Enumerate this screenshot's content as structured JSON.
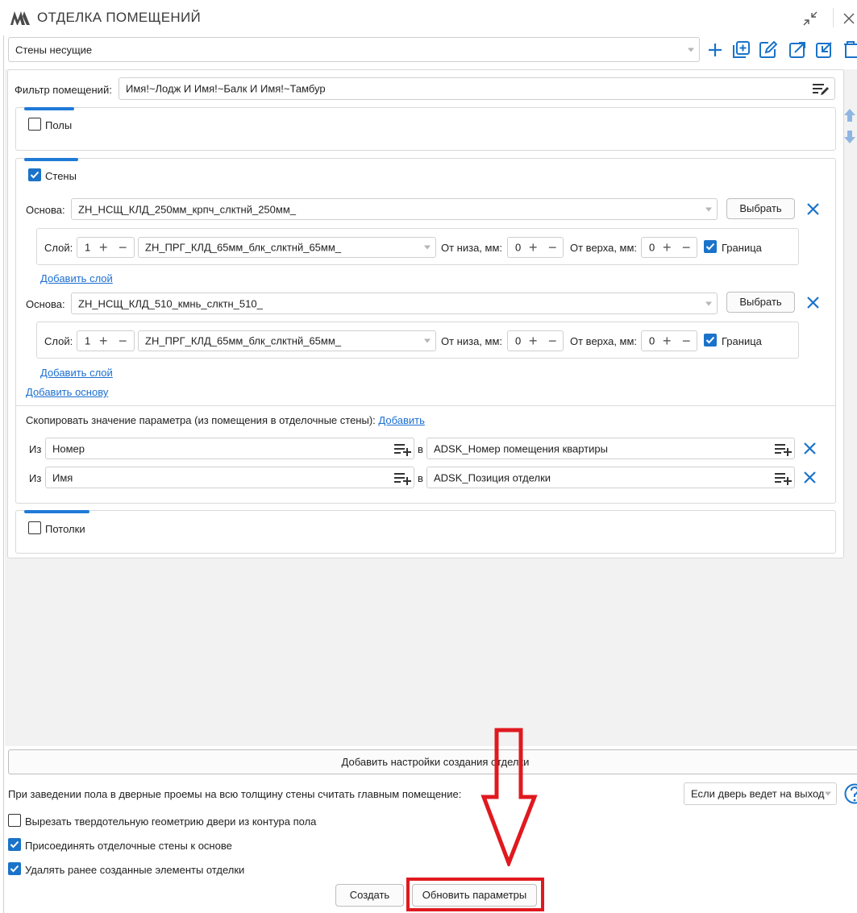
{
  "window": {
    "title": "ОТДЕЛКА ПОМЕЩЕНИЙ",
    "icons": [
      "app-logo-icon",
      "collapse-icon",
      "close-icon"
    ]
  },
  "preset": {
    "value": "Стены несущие"
  },
  "toolbar_icons": [
    "plus-icon",
    "add-copy-icon",
    "edit-icon",
    "export-icon",
    "import-icon",
    "delete-icon"
  ],
  "filter": {
    "label": "Фильтр помещений:",
    "value": "Имя!~Лодж И Имя!~Балк И Имя!~Тамбур"
  },
  "floors": {
    "label": "Полы",
    "checked": false
  },
  "walls": {
    "label": "Стены",
    "checked": true,
    "bases": [
      {
        "label": "Основа:",
        "value": "ZH_НСЩ_КЛД_250мм_крпч_слктнй_250мм_",
        "choose_label": "Выбрать",
        "layer": {
          "label": "Слой:",
          "index": "1",
          "value": "ZH_ПРГ_КЛД_65мм_блк_слктнй_65мм_",
          "bottom_label": "От низа, мм:",
          "bottom_value": "0",
          "top_label": "От верха, мм:",
          "top_value": "0",
          "border_label": "Граница",
          "border_checked": true
        },
        "add_layer": "Добавить слой"
      },
      {
        "label": "Основа:",
        "value": "ZH_НСЩ_КЛД_510_кмнь_слктн_510_",
        "choose_label": "Выбрать",
        "layer": {
          "label": "Слой:",
          "index": "1",
          "value": "ZH_ПРГ_КЛД_65мм_блк_слктнй_65мм_",
          "bottom_label": "От низа, мм:",
          "bottom_value": "0",
          "top_label": "От верха, мм:",
          "top_value": "0",
          "border_label": "Граница",
          "border_checked": true
        },
        "add_layer": "Добавить слой"
      }
    ],
    "add_base": "Добавить основу",
    "copy": {
      "label": "Скопировать значение параметра (из помещения в отделочные стены):",
      "add": "Добавить",
      "rows": [
        {
          "from_label": "Из",
          "from": "Номер",
          "to_label": "в",
          "to": "ADSK_Номер помещения квартиры"
        },
        {
          "from_label": "Из",
          "from": "Имя",
          "to_label": "в",
          "to": "ADSK_Позиция отделки"
        }
      ]
    }
  },
  "ceilings": {
    "label": "Потолки",
    "checked": false
  },
  "add_settings": "Добавить настройки создания отделки",
  "door_option": {
    "label": "При заведении пола в дверные проемы на всю толщину стены считать главным помещение:",
    "value": "Если дверь ведет на выход"
  },
  "options": [
    {
      "label": "Вырезать твердотельную геометрию двери из контура пола",
      "checked": false
    },
    {
      "label": "Присоединять отделочные стены к основе",
      "checked": true
    },
    {
      "label": "Удалять ранее созданные элементы отделки",
      "checked": true
    }
  ],
  "buttons": {
    "create": "Создать",
    "update": "Обновить параметры"
  },
  "colors": {
    "accent": "#1a73c9",
    "annotation": "#e0191f"
  }
}
